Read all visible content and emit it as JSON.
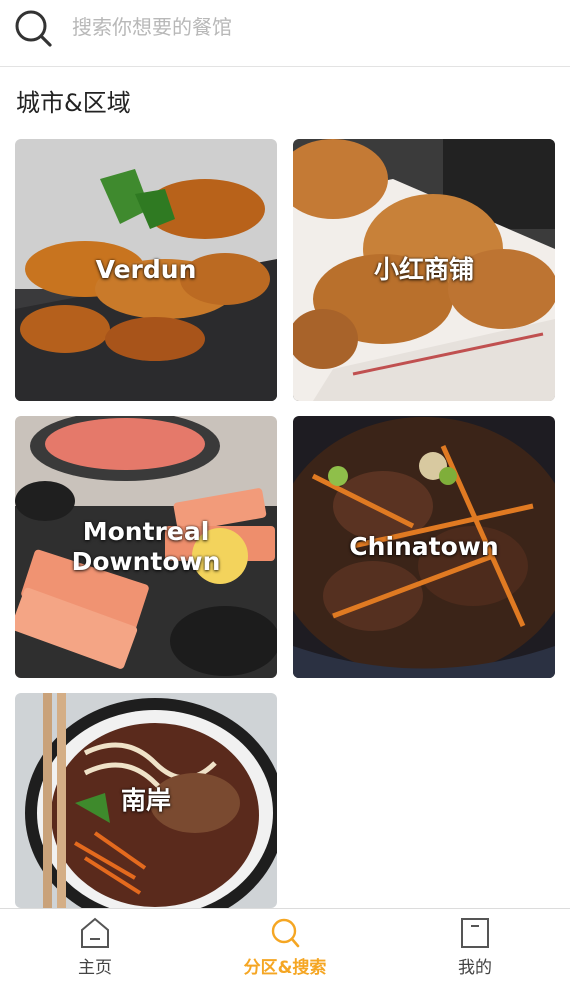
{
  "search": {
    "placeholder": "搜索你想要的餐馆",
    "icon": "search-icon"
  },
  "section": {
    "title": "城市&区域"
  },
  "areas": [
    {
      "label": "Verdun"
    },
    {
      "label": "小红商铺"
    },
    {
      "label": "Montreal\nDowntown"
    },
    {
      "label": "Chinatown"
    },
    {
      "label": "南岸"
    }
  ],
  "bottom_nav": {
    "items": [
      {
        "label": "主页",
        "icon": "home-icon"
      },
      {
        "label": "分区&搜索",
        "icon": "search-icon"
      },
      {
        "label": "我的",
        "icon": "profile-icon"
      }
    ],
    "active_index": 1,
    "active_color": "#f5a623"
  }
}
